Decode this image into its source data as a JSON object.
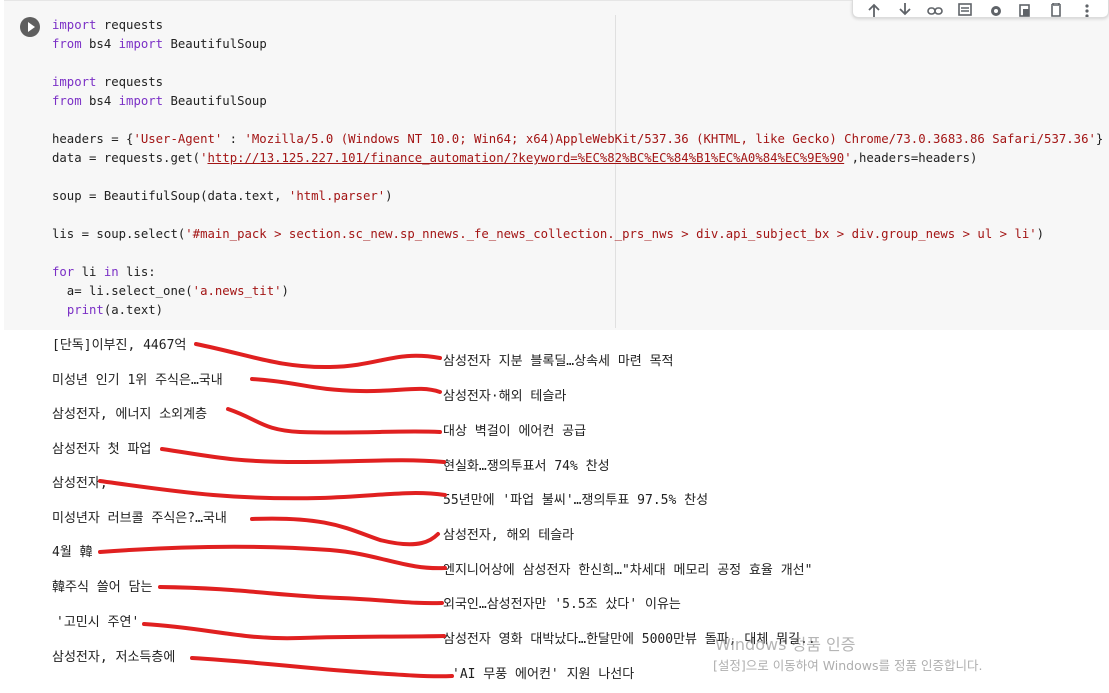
{
  "toolbar": {
    "icons": [
      "move-up-icon",
      "move-down-icon",
      "link-icon",
      "comment-icon",
      "settings-icon",
      "mirror-cell-icon",
      "delete-icon",
      "more-icon"
    ]
  },
  "code_lines": [
    [
      {
        "t": "import",
        "c": "kw"
      },
      {
        "t": " requests"
      }
    ],
    [
      {
        "t": "from",
        "c": "kw"
      },
      {
        "t": " bs4 "
      },
      {
        "t": "import",
        "c": "kw"
      },
      {
        "t": " BeautifulSoup"
      }
    ],
    [],
    [
      {
        "t": "import",
        "c": "kw"
      },
      {
        "t": " requests"
      }
    ],
    [
      {
        "t": "from",
        "c": "kw"
      },
      {
        "t": " bs4 "
      },
      {
        "t": "import",
        "c": "kw"
      },
      {
        "t": " BeautifulSoup"
      }
    ],
    [],
    [
      {
        "t": "headers = {"
      },
      {
        "t": "'User-Agent'",
        "c": "str"
      },
      {
        "t": " : "
      },
      {
        "t": "'Mozilla/5.0 (Windows NT 10.0; Win64; x64)AppleWebKit/537.36 (KHTML, like Gecko) Chrome/73.0.3683.86 Safari/537.36'",
        "c": "str"
      },
      {
        "t": "}"
      }
    ],
    [
      {
        "t": "data = requests.get("
      },
      {
        "t": "'",
        "c": "str"
      },
      {
        "t": "http://13.125.227.101/finance_automation/?keyword=%EC%82%BC%EC%84%B1%EC%A0%84%EC%9E%90",
        "c": "url"
      },
      {
        "t": "'",
        "c": "str"
      },
      {
        "t": ",headers=headers)"
      }
    ],
    [],
    [
      {
        "t": "soup = BeautifulSoup(data.text, "
      },
      {
        "t": "'html.parser'",
        "c": "str"
      },
      {
        "t": ")"
      }
    ],
    [],
    [
      {
        "t": "lis = soup.select("
      },
      {
        "t": "'#main_pack > section.sc_new.sp_nnews._fe_news_collection._prs_nws > div.api_subject_bx > div.group_news > ul > li'",
        "c": "str"
      },
      {
        "t": ")"
      }
    ],
    [],
    [
      {
        "t": "for",
        "c": "kw"
      },
      {
        "t": " li "
      },
      {
        "t": "in",
        "c": "kw"
      },
      {
        "t": " lis:"
      }
    ],
    [
      {
        "t": "  a= li.select_one("
      },
      {
        "t": "'a.news_tit'",
        "c": "str"
      },
      {
        "t": ")"
      }
    ],
    [
      {
        "t": "  "
      },
      {
        "t": "print",
        "c": "kw"
      },
      {
        "t": "(a.text)"
      }
    ]
  ],
  "output": {
    "left": [
      "[단독]이부진, 4467억",
      "미성년 인기 1위 주식은…국내",
      "삼성전자, 에너지 소외계층",
      "삼성전자 첫 파업",
      "삼성전자,",
      "미성년자 러브콜 주식은?…국내",
      "4월 韓",
      "韓주식 쓸어 담는",
      "'고민시 주연'",
      "삼성전자, 저소득층에"
    ],
    "right": [
      "삼성전자 지분 블록딜…상속세 마련 목적",
      "삼성전자·해외 테슬라",
      "대상 벽걸이 에어컨 공급",
      "현실화…쟁의투표서 74% 찬성",
      "55년만에 '파업 불씨'…쟁의투표 97.5% 찬성",
      "삼성전자, 해외 테슬라",
      "엔지니어상에 삼성전자 한신희…\"차세대 메모리 공정 효율 개선\"",
      "외국인…삼성전자만 '5.5조 샀다' 이유는",
      "삼성전자 영화 대박났다…한달만에 5000만뷰 돌파, 대체 뭐길..",
      "'AI 무풍 에어컨' 지원 나선다"
    ]
  },
  "watermark": {
    "title": "Windows 정품 인증",
    "subtitle": "[설정]으로 이동하여 Windows를 정품 인증합니다."
  },
  "colors": {
    "keyword": "#7b30c6",
    "string": "#a31515",
    "annotation_stroke": "#e02020",
    "cell_bg": "#f7f7f7"
  }
}
